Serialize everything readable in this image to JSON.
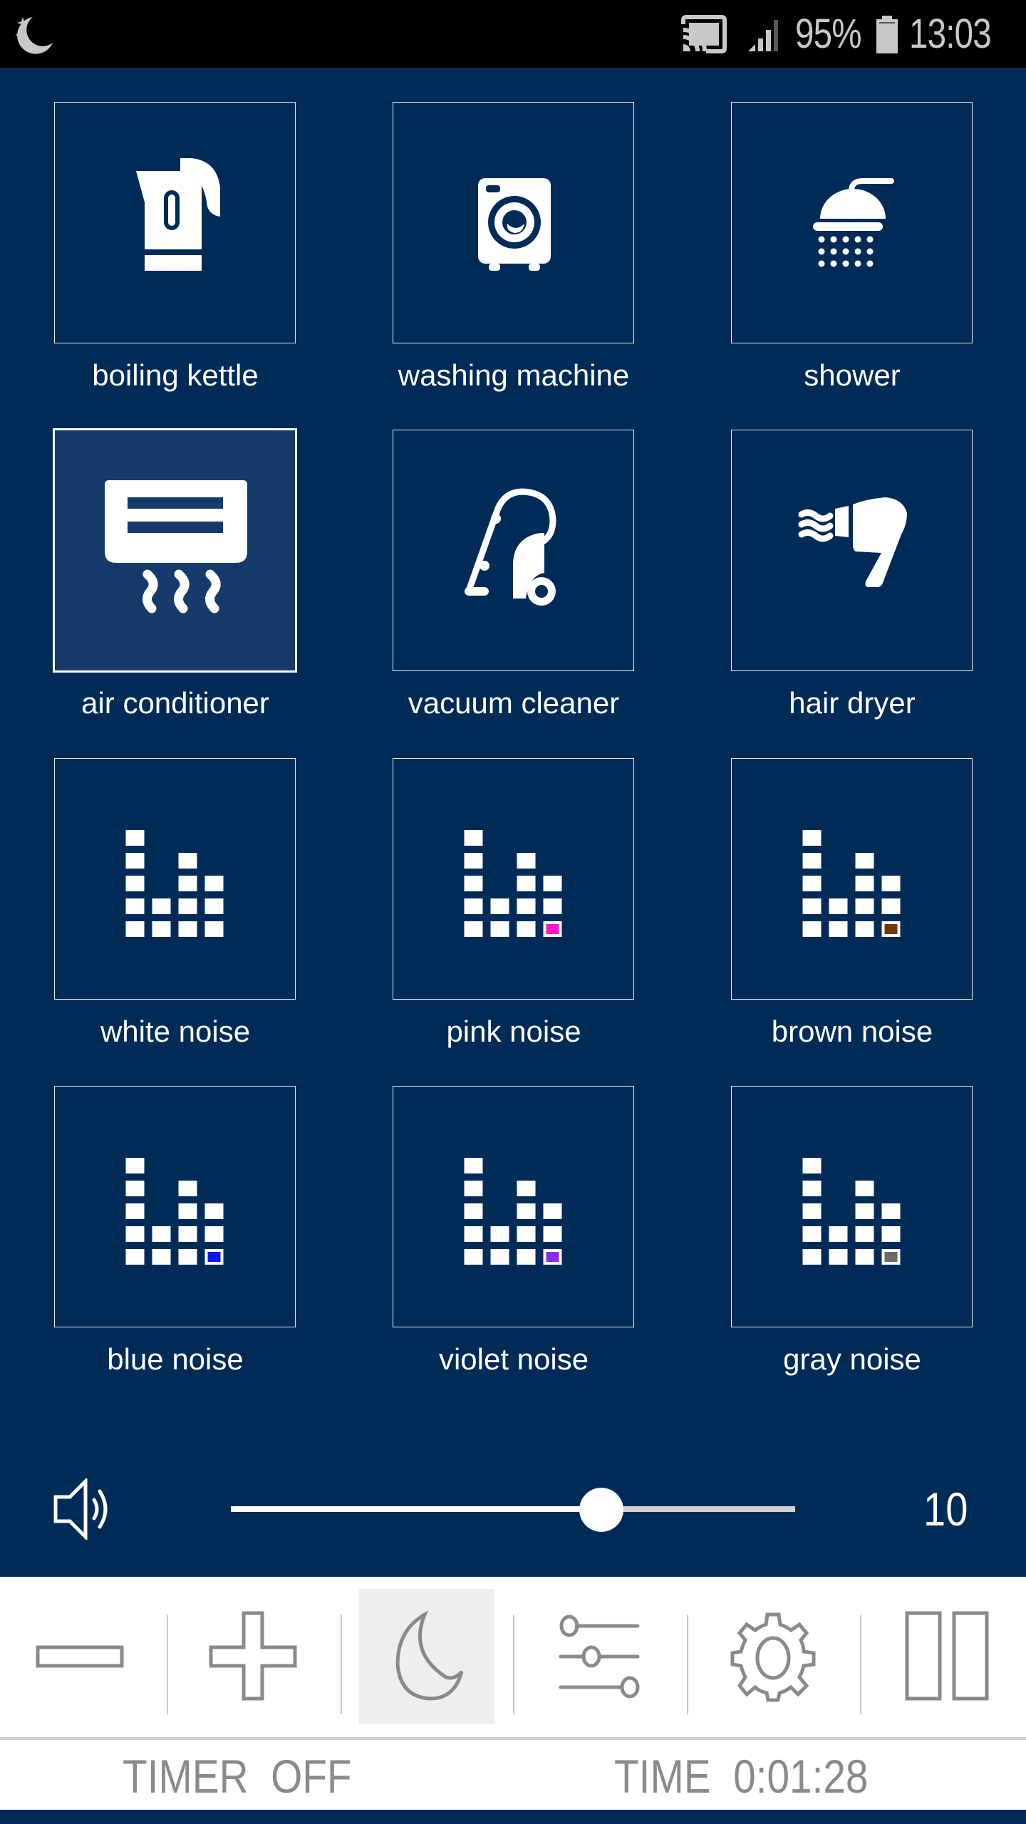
{
  "status_bar": {
    "left_icon": "sleep-moon-icon",
    "icons": [
      "cast-icon",
      "signal-icon",
      "battery-icon"
    ],
    "battery_percent": "95%",
    "time": "13:03"
  },
  "sounds": [
    {
      "id": "boiling-kettle",
      "label": "boiling kettle",
      "icon": "kettle-icon",
      "active": false
    },
    {
      "id": "washing-machine",
      "label": "washing machine",
      "icon": "washing-machine-icon",
      "active": false
    },
    {
      "id": "shower",
      "label": "shower",
      "icon": "shower-icon",
      "active": false
    },
    {
      "id": "air-conditioner",
      "label": "air conditioner",
      "icon": "air-conditioner-icon",
      "active": true
    },
    {
      "id": "vacuum-cleaner",
      "label": "vacuum cleaner",
      "icon": "vacuum-cleaner-icon",
      "active": false
    },
    {
      "id": "hair-dryer",
      "label": "hair dryer",
      "icon": "hair-dryer-icon",
      "active": false
    },
    {
      "id": "white-noise",
      "label": "white noise",
      "icon": "noise-bars-icon",
      "active": false,
      "accent": null
    },
    {
      "id": "pink-noise",
      "label": "pink noise",
      "icon": "noise-bars-icon",
      "active": false,
      "accent": "#ff17c8"
    },
    {
      "id": "brown-noise",
      "label": "brown noise",
      "icon": "noise-bars-icon",
      "active": false,
      "accent": "#6e3b0c"
    },
    {
      "id": "blue-noise",
      "label": "blue noise",
      "icon": "noise-bars-icon",
      "active": false,
      "accent": "#0a18f0"
    },
    {
      "id": "violet-noise",
      "label": "violet noise",
      "icon": "noise-bars-icon",
      "active": false,
      "accent": "#8a2be8"
    },
    {
      "id": "gray-noise",
      "label": "gray noise",
      "icon": "noise-bars-icon",
      "active": false,
      "accent": "#6a6a6a"
    }
  ],
  "volume": {
    "icon": "speaker-icon",
    "value": "10",
    "level_fraction": 0.656
  },
  "toolbar": {
    "buttons": [
      {
        "id": "decrease",
        "icon": "minus-icon",
        "active": false
      },
      {
        "id": "increase",
        "icon": "plus-icon",
        "active": false
      },
      {
        "id": "sleep",
        "icon": "moon-icon",
        "active": true
      },
      {
        "id": "mixer",
        "icon": "sliders-icon",
        "active": false
      },
      {
        "id": "settings",
        "icon": "gear-icon",
        "active": false
      },
      {
        "id": "pause",
        "icon": "pause-icon",
        "active": false
      }
    ]
  },
  "timer": {
    "label": "TIMER  OFF",
    "elapsed_label": "TIME  0:01:28"
  },
  "colors": {
    "background": "#002b57",
    "active_tile": "#163b6a",
    "toolbar_icon": "#8a8a8a",
    "toolbar_active": "#eeeeee"
  }
}
